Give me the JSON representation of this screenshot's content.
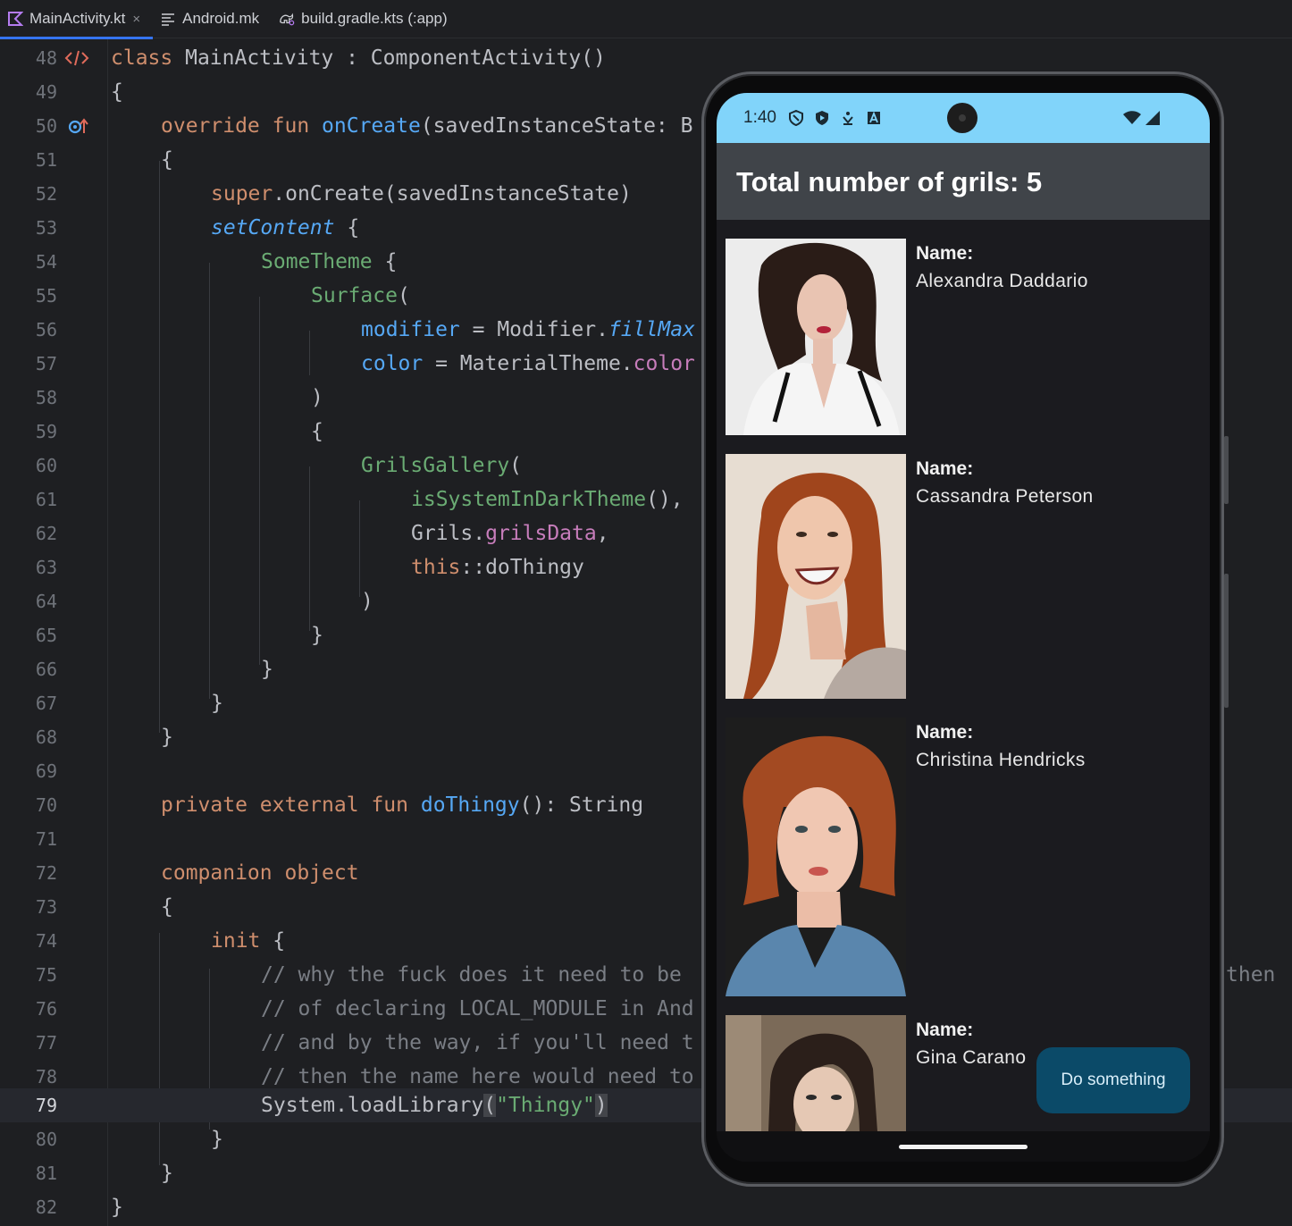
{
  "tabs": [
    {
      "label": "MainActivity.kt",
      "icon": "kotlin-file-icon",
      "active": true,
      "close": "×"
    },
    {
      "label": "Android.mk",
      "icon": "text-file-icon",
      "active": false
    },
    {
      "label": "build.gradle.kts (:app)",
      "icon": "gradle-icon",
      "active": false
    }
  ],
  "editor": {
    "current_line": "79",
    "lines": [
      {
        "n": "48"
      },
      {
        "n": "49"
      },
      {
        "n": "50"
      },
      {
        "n": "51"
      },
      {
        "n": "52"
      },
      {
        "n": "53"
      },
      {
        "n": "54"
      },
      {
        "n": "55"
      },
      {
        "n": "56"
      },
      {
        "n": "57"
      },
      {
        "n": "58"
      },
      {
        "n": "59"
      },
      {
        "n": "60"
      },
      {
        "n": "61"
      },
      {
        "n": "62"
      },
      {
        "n": "63"
      },
      {
        "n": "64"
      },
      {
        "n": "65"
      },
      {
        "n": "66"
      },
      {
        "n": "67"
      },
      {
        "n": "68"
      },
      {
        "n": "69"
      },
      {
        "n": "70"
      },
      {
        "n": "71"
      },
      {
        "n": "72"
      },
      {
        "n": "73"
      },
      {
        "n": "74"
      },
      {
        "n": "75"
      },
      {
        "n": "76"
      },
      {
        "n": "77"
      },
      {
        "n": "78"
      },
      {
        "n": "79"
      },
      {
        "n": "80"
      },
      {
        "n": "81"
      },
      {
        "n": "82"
      }
    ],
    "code": {
      "l48": [
        "class",
        " MainActivity : ComponentActivity()"
      ],
      "l49": "{",
      "l50": [
        "override",
        " ",
        "fun",
        " ",
        "onCreate",
        "(savedInstanceState: B"
      ],
      "l51": "{",
      "l52": [
        "super",
        ".onCreate(savedInstanceState)"
      ],
      "l53": [
        "setContent",
        " {"
      ],
      "l54": [
        "SomeTheme",
        " {"
      ],
      "l55": [
        "Surface",
        "("
      ],
      "l56": [
        "modifier",
        " = Modifier.",
        "fillMax"
      ],
      "l57": [
        "color",
        " = MaterialTheme.",
        "color"
      ],
      "l58": ")",
      "l59": "{",
      "l60": [
        "GrilsGallery",
        "("
      ],
      "l61": [
        "isSystemInDarkTheme",
        "(),"
      ],
      "l62": [
        "Grils.",
        "grilsData",
        ","
      ],
      "l63": [
        "this",
        "::doThingy"
      ],
      "l64": ")",
      "l65": "}",
      "l66": "}",
      "l67": "}",
      "l68": "}",
      "l70": [
        "private",
        " ",
        "external",
        " ",
        "fun",
        " ",
        "doThingy",
        "(): String"
      ],
      "l72": [
        "companion",
        " ",
        "object"
      ],
      "l73": "{",
      "l74": [
        "init",
        " {"
      ],
      "l75": "// why the fuck does it need to be",
      "l75_tail": "then",
      "l76": "// of declaring LOCAL_MODULE in And",
      "l77": "// and by the way, if you'll need t",
      "l78": "// then the name here would need to",
      "l79": [
        "System.loadLibrary",
        "(",
        "\"Thingy\"",
        ")"
      ],
      "l80": "}",
      "l81": "}",
      "l82": "}"
    }
  },
  "phone": {
    "status_time": "1:40",
    "status_icons": [
      "shield-icon",
      "play-protect-icon",
      "download-icon",
      "font-icon"
    ],
    "signal_icons": [
      "wifi-icon",
      "cellular-signal-icon"
    ],
    "app_title": "Total number of grils: 5",
    "name_label": "Name:",
    "items": [
      {
        "name": "Alexandra Daddario",
        "hair": "#2a1c17",
        "bg": "#ececec",
        "shirt": "#f5f5f5"
      },
      {
        "name": "Cassandra Peterson",
        "hair": "#a0451c",
        "bg": "#e7ddd2",
        "shirt": "#b5a9a1"
      },
      {
        "name": "Christina Hendricks",
        "hair": "#a34a22",
        "bg": "#1d1d1d",
        "shirt": "#5a86ad"
      },
      {
        "name": "Gina Carano",
        "hair": "#2b1f1a",
        "bg": "#7b6a58",
        "shirt": "#e5c8b4"
      }
    ],
    "fab_label": "Do something",
    "accent": "#81d4fa"
  }
}
